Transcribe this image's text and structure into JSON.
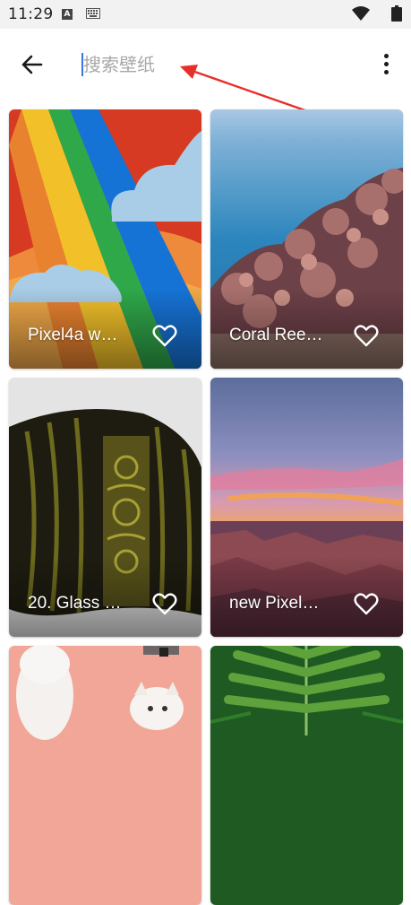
{
  "status_bar": {
    "time": "11:29",
    "icons": [
      "a-icon",
      "keyboard-icon",
      "wifi-icon",
      "battery-icon"
    ]
  },
  "search": {
    "placeholder": "搜索壁纸",
    "value": ""
  },
  "wallpapers": [
    {
      "title": "Pixel4a w…",
      "favorite": false
    },
    {
      "title": "Coral Ree…",
      "favorite": false
    },
    {
      "title": "20. Glass …",
      "favorite": false
    },
    {
      "title": "new Pixel…",
      "favorite": false
    },
    {
      "title": "",
      "favorite": false
    },
    {
      "title": "",
      "favorite": false
    }
  ],
  "colors": {
    "accent": "#3a74e0",
    "annotation": "#e8302a"
  }
}
